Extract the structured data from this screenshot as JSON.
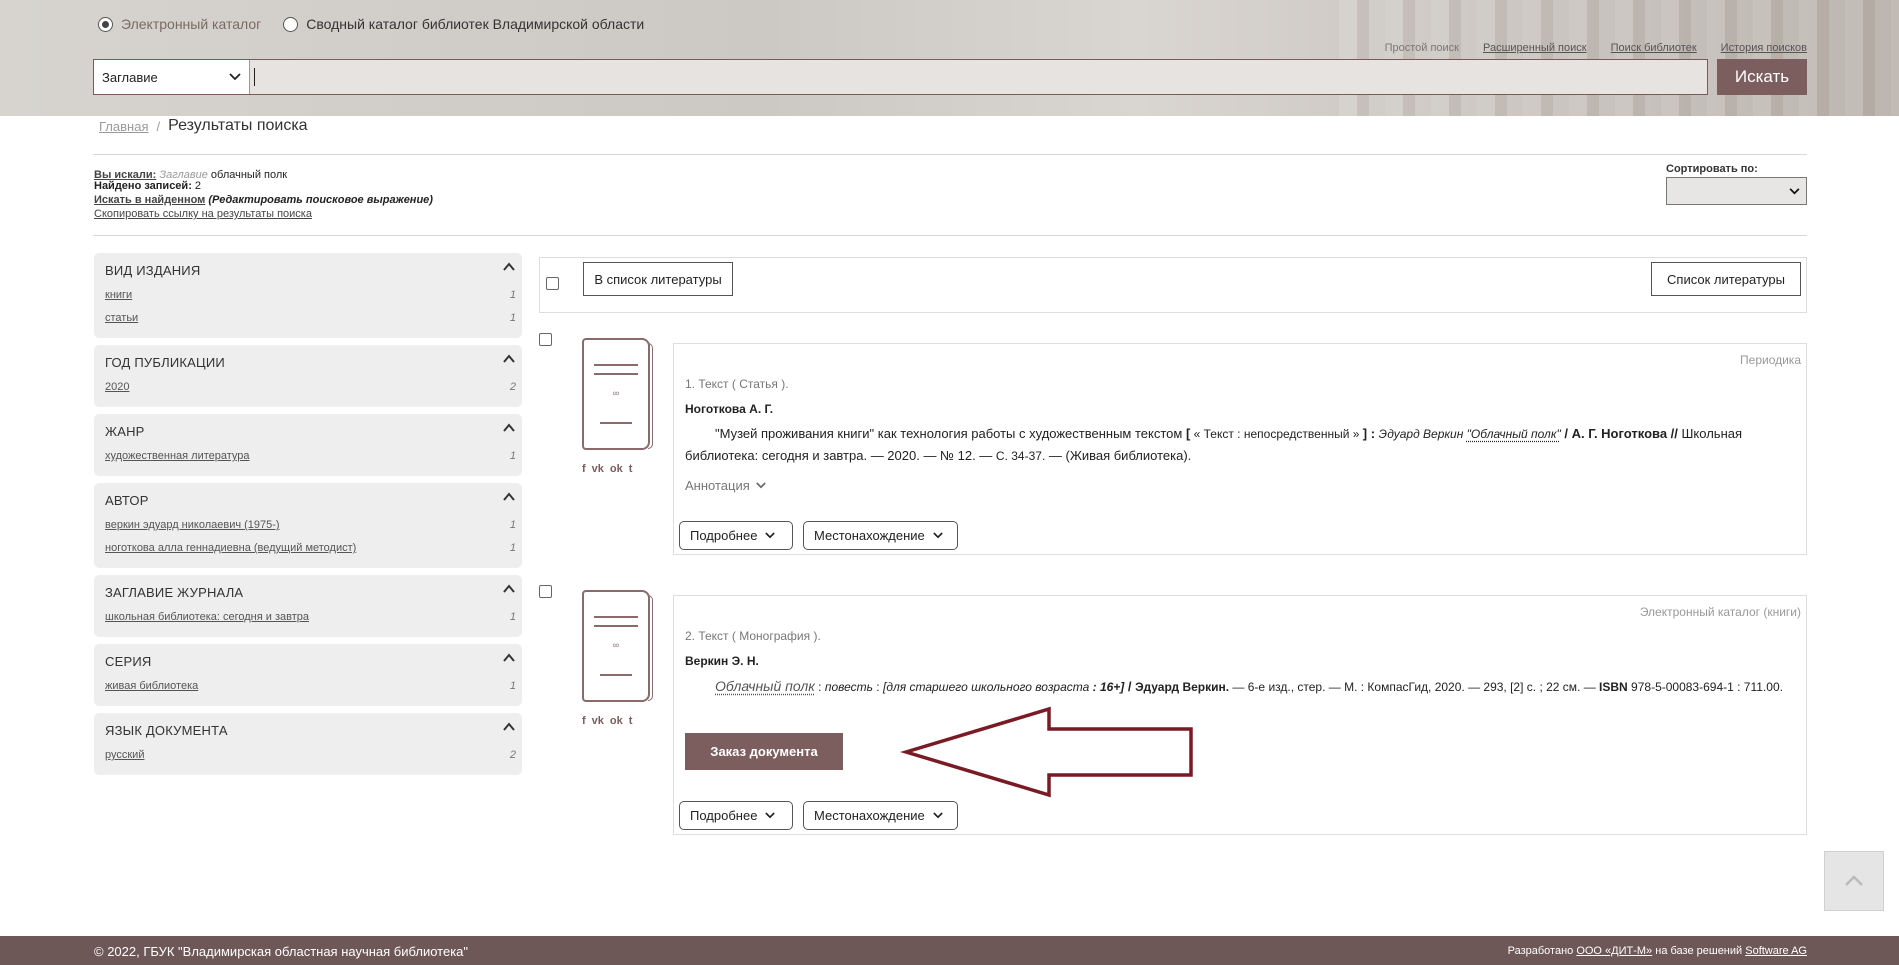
{
  "header": {
    "radio_catalog": "Электронный каталог",
    "radio_union": "Сводный каталог библиотек Владимирской области",
    "links": [
      "Простой поиск",
      "Расширенный поиск",
      "Поиск библиотек",
      "История поисков"
    ],
    "search_field": "Заглавие",
    "search_value": "",
    "search_button": "Искать"
  },
  "breadcrumb": {
    "home": "Главная",
    "sep": "/",
    "current": "Результаты поиска"
  },
  "query": {
    "searched_label": "Вы искали:",
    "searched_field": "Заглавие",
    "searched_value": "облачный полк",
    "found_label": "Найдено записей:",
    "found_count": "2",
    "search_in_found": "Искать в найденном",
    "edit_expression": "(Редактировать поисковое выражение)",
    "copy_link": "Скопировать ссылку на результаты поиска"
  },
  "sort": {
    "label": "Сортировать по:",
    "value": ""
  },
  "facets": [
    {
      "title": "ВИД ИЗДАНИЯ",
      "items": [
        {
          "name": "книги",
          "count": "1"
        },
        {
          "name": "статьи",
          "count": "1"
        }
      ]
    },
    {
      "title": "ГОД ПУБЛИКАЦИИ",
      "items": [
        {
          "name": "2020",
          "count": "2"
        }
      ]
    },
    {
      "title": "ЖАНР",
      "items": [
        {
          "name": "художественная литература",
          "count": "1"
        }
      ]
    },
    {
      "title": "АВТОР",
      "items": [
        {
          "name": "веркин эдуард николаевич (1975-)",
          "count": "1"
        },
        {
          "name": "ноготкова алла геннадиевна (ведущий методист)",
          "count": "1"
        }
      ]
    },
    {
      "title": "ЗАГЛАВИЕ ЖУРНАЛА",
      "items": [
        {
          "name": "школьная библиотека: сегодня и завтра",
          "count": "1"
        }
      ]
    },
    {
      "title": "СЕРИЯ",
      "items": [
        {
          "name": "живая библиотека",
          "count": "1"
        }
      ]
    },
    {
      "title": "ЯЗЫК ДОКУМЕНТА",
      "items": [
        {
          "name": "русский",
          "count": "2"
        }
      ]
    }
  ],
  "toolbar": {
    "add_to_list": "В список литературы",
    "list": "Список литературы"
  },
  "social": {
    "fb": "f",
    "vk": "vk",
    "ok": "ok",
    "tw": "t"
  },
  "thumb_symbol": "∞",
  "results": [
    {
      "source": "Периодика",
      "kind": "1. Текст ( Статья ).",
      "author": "Ноготкова А. Г.",
      "d_title": "\"Музей проживания книги\" как технология работы с художественным текстом",
      "d_bracket_open": " [",
      "d_medium": " « Текст : непосредственный » ",
      "d_bracket_close": "] : ",
      "d_ref_author": "Эдуард Веркин ",
      "d_ref_title": "\"Облачный полк\"",
      "d_slash": " / ",
      "d_resp": "А. Г. Ноготкова",
      "d_dslash": " // ",
      "d_source": "Школьная библиотека: сегодня и завтра. — 2020. — № 12. — ",
      "d_pages": "С. 34-37.",
      "d_series": " — (Живая библиотека).",
      "annotation": "Аннотация",
      "more": "Подробнее",
      "location": "Местонахождение"
    },
    {
      "source": "Электронный каталог (книги)",
      "kind": "2. Текст ( Монография ).",
      "author": "Веркин Э. Н.",
      "d_title": "Облачный полк",
      "d_colon": " : ",
      "d_genre": "повесть",
      "d_colon2": " : ",
      "d_age": "[для старшего школьного возраста",
      "d_age2": " : 16+]",
      "d_slash": " / ",
      "d_resp": "Эдуард Веркин.",
      "d_edition": " — 6-е изд., стер. — М. : КомпасГид, 2020. — 293, [2] с. ; 22 см. — ",
      "d_isbn_label": "ISBN",
      "d_isbn": " 978-5-00083-694-1 : 711.00.",
      "order": "Заказ документа",
      "more": "Подробнее",
      "location": "Местонахождение"
    }
  ],
  "footer": {
    "copyright": "© 2022, ГБУК \"Владимирская областная научная библиотека\"",
    "dev_prefix": "Разработано ",
    "dev_company": "ООО «ДИТ-М»",
    "dev_mid": " на базе решений ",
    "dev_vendor": "Software AG"
  },
  "colors": {
    "accent": "#7c5e5f",
    "footer": "#6e5857",
    "arrow": "#7a1a24"
  }
}
